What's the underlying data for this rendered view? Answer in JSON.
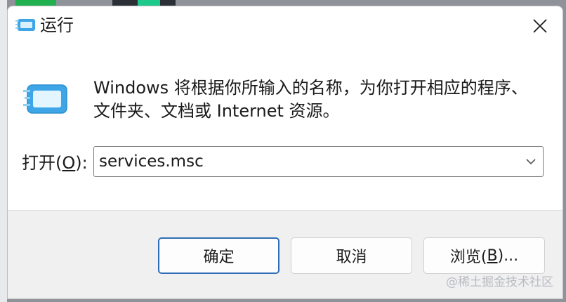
{
  "window": {
    "title": "运行"
  },
  "description": "Windows 将根据你所输入的名称，为你打开相应的程序、文件夹、文档或 Internet 资源。",
  "open_field": {
    "label_prefix": "打开(",
    "label_accel": "O",
    "label_suffix": "):",
    "value": "services.msc"
  },
  "buttons": {
    "ok": "确定",
    "cancel": "取消",
    "browse_prefix": "浏览(",
    "browse_accel": "B",
    "browse_suffix": ")..."
  },
  "watermark": "@稀土掘金技术社区",
  "icons": {
    "title": "run-app-icon",
    "big": "run-app-icon",
    "close": "close-icon",
    "dropdown": "chevron-down-icon"
  },
  "colors": {
    "accent": "#2f6eb7",
    "footer_bg": "#f0f0f0",
    "icon_blue": "#3ea6e6"
  }
}
